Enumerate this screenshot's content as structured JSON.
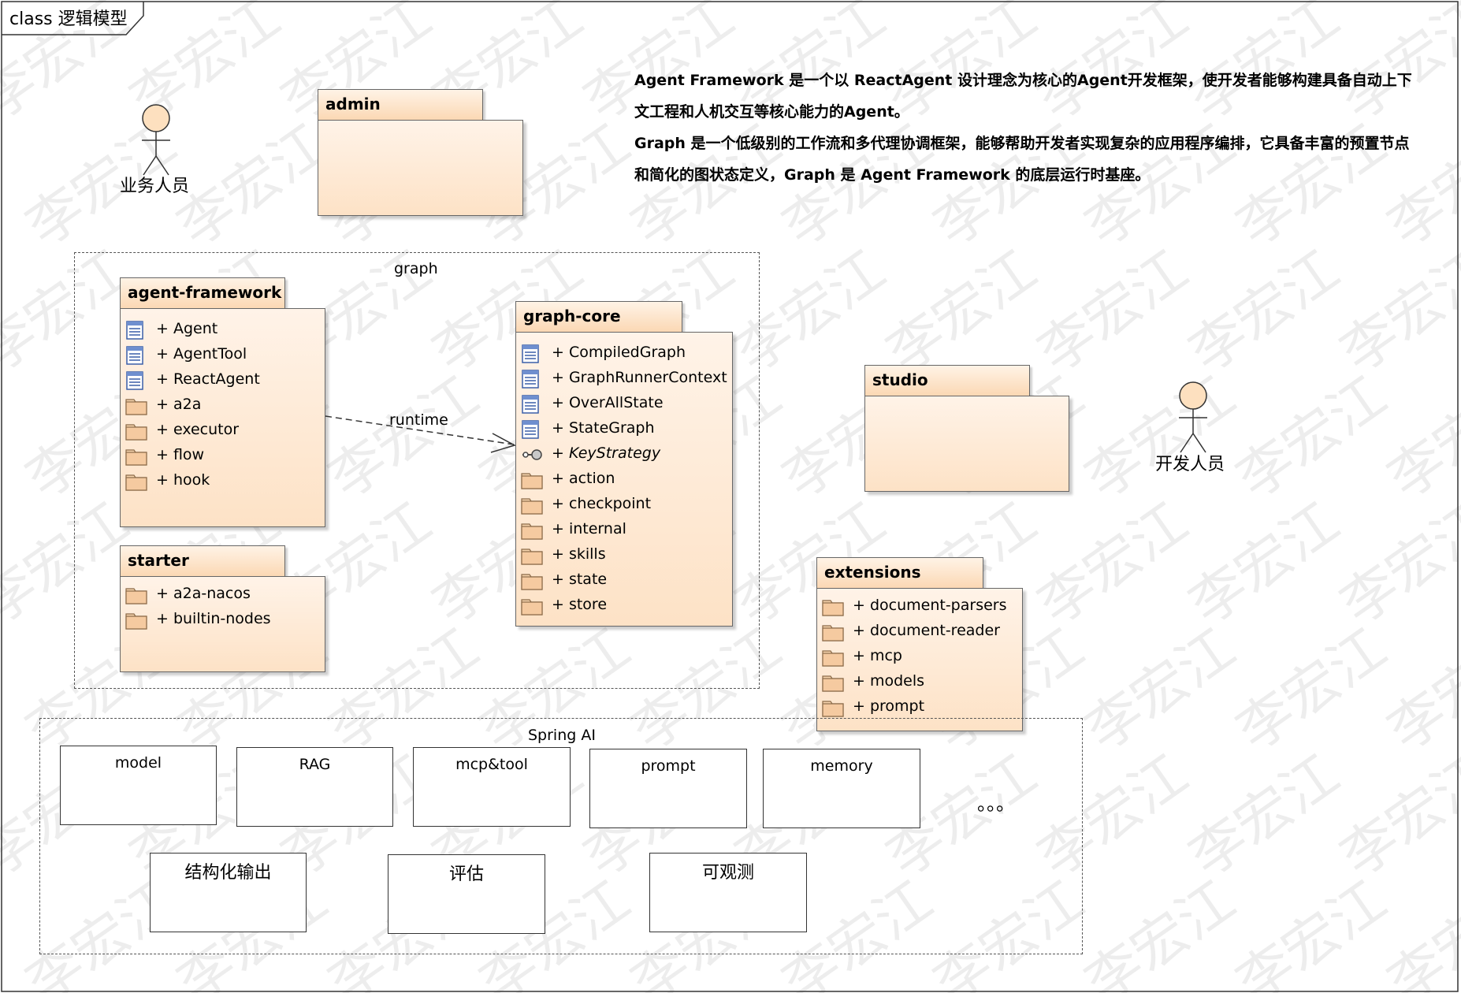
{
  "diagram": {
    "frame_label": "class 逻辑模型",
    "note": [
      "Agent Framework 是一个以 ReactAgent 设计理念为核心的Agent开发框架，使开发者能够构建具备自动上下文工程和人机交互等核心能力的Agent。",
      "Graph 是一个低级别的工作流和多代理协调框架，能够帮助开发者实现复杂的应用程序编排，它具备丰富的预置节点和简化的图状态定义，Graph 是 Agent Framework 的底层运行时基座。"
    ],
    "actors": {
      "business": "业务人员",
      "developer": "开发人员"
    },
    "packages": {
      "admin": {
        "name": "admin"
      },
      "studio": {
        "name": "studio"
      },
      "agent_framework": {
        "name": "agent-framework",
        "members": [
          {
            "label": "+ Agent",
            "icon": "class-icon"
          },
          {
            "label": "+ AgentTool",
            "icon": "class-icon"
          },
          {
            "label": "+ ReactAgent",
            "icon": "class-icon"
          },
          {
            "label": "+ a2a",
            "icon": "folder-icon"
          },
          {
            "label": "+ executor",
            "icon": "folder-icon"
          },
          {
            "label": "+ flow",
            "icon": "folder-icon"
          },
          {
            "label": "+ hook",
            "icon": "folder-icon"
          }
        ]
      },
      "starter": {
        "name": "starter",
        "members": [
          {
            "label": "+ a2a-nacos",
            "icon": "folder-icon"
          },
          {
            "label": "+ builtin-nodes",
            "icon": "folder-icon"
          }
        ]
      },
      "graph_core": {
        "name": "graph-core",
        "members": [
          {
            "label": "+ CompiledGraph",
            "icon": "class-icon"
          },
          {
            "label": "+ GraphRunnerContext",
            "icon": "class-icon"
          },
          {
            "label": "+ OverAllState",
            "icon": "class-icon"
          },
          {
            "label": "+ StateGraph",
            "icon": "class-icon"
          },
          {
            "label": "+ KeyStrategy",
            "icon": "interface-icon",
            "italic": true
          },
          {
            "label": "+ action",
            "icon": "folder-icon"
          },
          {
            "label": "+ checkpoint",
            "icon": "folder-icon"
          },
          {
            "label": "+ internal",
            "icon": "folder-icon"
          },
          {
            "label": "+ skills",
            "icon": "folder-icon"
          },
          {
            "label": "+ state",
            "icon": "folder-icon"
          },
          {
            "label": "+ store",
            "icon": "folder-icon"
          }
        ]
      },
      "extensions": {
        "name": "extensions",
        "members": [
          {
            "label": "+ document-parsers",
            "icon": "folder-icon"
          },
          {
            "label": "+ document-reader",
            "icon": "folder-icon"
          },
          {
            "label": "+ mcp",
            "icon": "folder-icon"
          },
          {
            "label": "+ models",
            "icon": "folder-icon"
          },
          {
            "label": "+ prompt",
            "icon": "folder-icon"
          }
        ]
      }
    },
    "graph_boundary": {
      "label": "graph"
    },
    "dependency": {
      "label": "runtime"
    },
    "spring_ai": {
      "label": "Spring AI",
      "components": [
        "model",
        "RAG",
        "mcp&tool",
        "prompt",
        "memory"
      ],
      "components_row2": [
        "结构化输出",
        "评估",
        "可观测"
      ],
      "ellipsis": "。。。"
    },
    "watermark": "李宏江"
  }
}
